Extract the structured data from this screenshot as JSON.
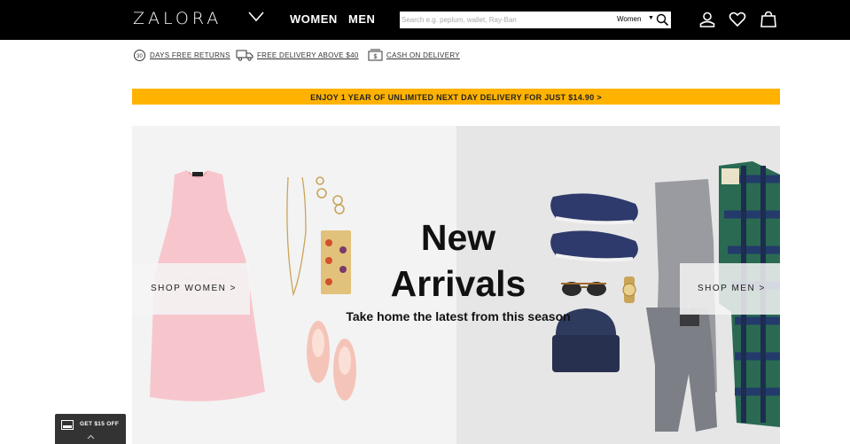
{
  "header": {
    "logo": "ZALORA",
    "nav": {
      "women": "WOMEN",
      "men": "MEN"
    },
    "search": {
      "placeholder": "Search e.g. peplum, wallet, Ray-Ban",
      "scope": "Women"
    },
    "icons": [
      "chevron-down-icon",
      "search-icon",
      "user-icon",
      "heart-icon",
      "bag-icon"
    ]
  },
  "usp": {
    "returns": "DAYS FREE RETURNS",
    "returns_badge": "30",
    "delivery": "FREE DELIVERY ABOVE $40",
    "cod": "CASH ON DELIVERY",
    "cod_symbol": "$"
  },
  "promo": {
    "text": "ENJOY 1 YEAR OF UNLIMITED NEXT DAY DELIVERY FOR JUST $14.90 >"
  },
  "hero": {
    "title_line1": "New",
    "title_line2": "Arrivals",
    "subtitle": "Take home the latest from this season",
    "shop_women": "SHOP WOMEN >",
    "shop_men": "SHOP MEN >"
  },
  "voucher": {
    "label": "GET $15 OFF"
  },
  "colors": {
    "header_bg": "#000000",
    "promo_bg": "#ffb300",
    "voucher_bg": "#333333"
  }
}
